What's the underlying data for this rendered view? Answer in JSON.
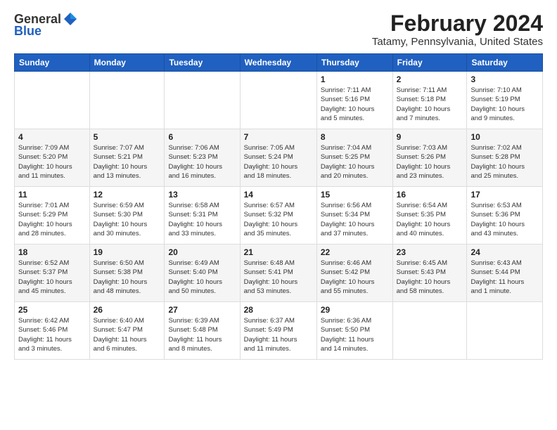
{
  "logo": {
    "general": "General",
    "blue": "Blue"
  },
  "title": "February 2024",
  "subtitle": "Tatamy, Pennsylvania, United States",
  "headers": [
    "Sunday",
    "Monday",
    "Tuesday",
    "Wednesday",
    "Thursday",
    "Friday",
    "Saturday"
  ],
  "weeks": [
    [
      {
        "day": "",
        "info": ""
      },
      {
        "day": "",
        "info": ""
      },
      {
        "day": "",
        "info": ""
      },
      {
        "day": "",
        "info": ""
      },
      {
        "day": "1",
        "info": "Sunrise: 7:11 AM\nSunset: 5:16 PM\nDaylight: 10 hours\nand 5 minutes."
      },
      {
        "day": "2",
        "info": "Sunrise: 7:11 AM\nSunset: 5:18 PM\nDaylight: 10 hours\nand 7 minutes."
      },
      {
        "day": "3",
        "info": "Sunrise: 7:10 AM\nSunset: 5:19 PM\nDaylight: 10 hours\nand 9 minutes."
      }
    ],
    [
      {
        "day": "4",
        "info": "Sunrise: 7:09 AM\nSunset: 5:20 PM\nDaylight: 10 hours\nand 11 minutes."
      },
      {
        "day": "5",
        "info": "Sunrise: 7:07 AM\nSunset: 5:21 PM\nDaylight: 10 hours\nand 13 minutes."
      },
      {
        "day": "6",
        "info": "Sunrise: 7:06 AM\nSunset: 5:23 PM\nDaylight: 10 hours\nand 16 minutes."
      },
      {
        "day": "7",
        "info": "Sunrise: 7:05 AM\nSunset: 5:24 PM\nDaylight: 10 hours\nand 18 minutes."
      },
      {
        "day": "8",
        "info": "Sunrise: 7:04 AM\nSunset: 5:25 PM\nDaylight: 10 hours\nand 20 minutes."
      },
      {
        "day": "9",
        "info": "Sunrise: 7:03 AM\nSunset: 5:26 PM\nDaylight: 10 hours\nand 23 minutes."
      },
      {
        "day": "10",
        "info": "Sunrise: 7:02 AM\nSunset: 5:28 PM\nDaylight: 10 hours\nand 25 minutes."
      }
    ],
    [
      {
        "day": "11",
        "info": "Sunrise: 7:01 AM\nSunset: 5:29 PM\nDaylight: 10 hours\nand 28 minutes."
      },
      {
        "day": "12",
        "info": "Sunrise: 6:59 AM\nSunset: 5:30 PM\nDaylight: 10 hours\nand 30 minutes."
      },
      {
        "day": "13",
        "info": "Sunrise: 6:58 AM\nSunset: 5:31 PM\nDaylight: 10 hours\nand 33 minutes."
      },
      {
        "day": "14",
        "info": "Sunrise: 6:57 AM\nSunset: 5:32 PM\nDaylight: 10 hours\nand 35 minutes."
      },
      {
        "day": "15",
        "info": "Sunrise: 6:56 AM\nSunset: 5:34 PM\nDaylight: 10 hours\nand 37 minutes."
      },
      {
        "day": "16",
        "info": "Sunrise: 6:54 AM\nSunset: 5:35 PM\nDaylight: 10 hours\nand 40 minutes."
      },
      {
        "day": "17",
        "info": "Sunrise: 6:53 AM\nSunset: 5:36 PM\nDaylight: 10 hours\nand 43 minutes."
      }
    ],
    [
      {
        "day": "18",
        "info": "Sunrise: 6:52 AM\nSunset: 5:37 PM\nDaylight: 10 hours\nand 45 minutes."
      },
      {
        "day": "19",
        "info": "Sunrise: 6:50 AM\nSunset: 5:38 PM\nDaylight: 10 hours\nand 48 minutes."
      },
      {
        "day": "20",
        "info": "Sunrise: 6:49 AM\nSunset: 5:40 PM\nDaylight: 10 hours\nand 50 minutes."
      },
      {
        "day": "21",
        "info": "Sunrise: 6:48 AM\nSunset: 5:41 PM\nDaylight: 10 hours\nand 53 minutes."
      },
      {
        "day": "22",
        "info": "Sunrise: 6:46 AM\nSunset: 5:42 PM\nDaylight: 10 hours\nand 55 minutes."
      },
      {
        "day": "23",
        "info": "Sunrise: 6:45 AM\nSunset: 5:43 PM\nDaylight: 10 hours\nand 58 minutes."
      },
      {
        "day": "24",
        "info": "Sunrise: 6:43 AM\nSunset: 5:44 PM\nDaylight: 11 hours\nand 1 minute."
      }
    ],
    [
      {
        "day": "25",
        "info": "Sunrise: 6:42 AM\nSunset: 5:46 PM\nDaylight: 11 hours\nand 3 minutes."
      },
      {
        "day": "26",
        "info": "Sunrise: 6:40 AM\nSunset: 5:47 PM\nDaylight: 11 hours\nand 6 minutes."
      },
      {
        "day": "27",
        "info": "Sunrise: 6:39 AM\nSunset: 5:48 PM\nDaylight: 11 hours\nand 8 minutes."
      },
      {
        "day": "28",
        "info": "Sunrise: 6:37 AM\nSunset: 5:49 PM\nDaylight: 11 hours\nand 11 minutes."
      },
      {
        "day": "29",
        "info": "Sunrise: 6:36 AM\nSunset: 5:50 PM\nDaylight: 11 hours\nand 14 minutes."
      },
      {
        "day": "",
        "info": ""
      },
      {
        "day": "",
        "info": ""
      }
    ]
  ]
}
